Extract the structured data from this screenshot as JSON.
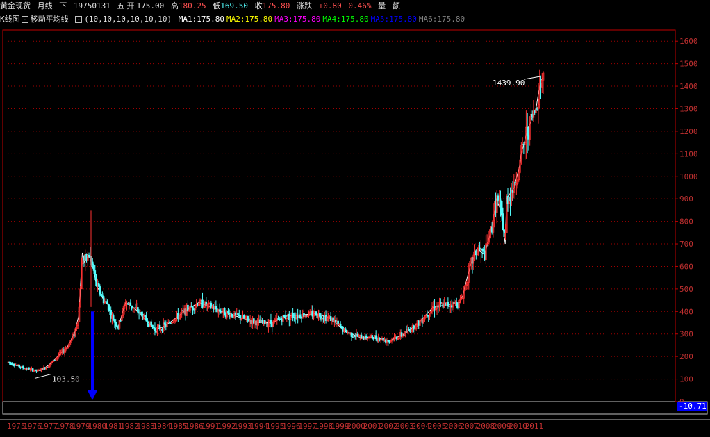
{
  "header": {
    "instrument": "黄金现货",
    "period": "月线",
    "direction": "下",
    "date": "19750131",
    "weekday": "五",
    "open_label": "开",
    "open": "175.00",
    "high_label": "高",
    "high": "180.25",
    "low_label": "低",
    "low": "169.50",
    "close_label": "收",
    "close": "175.80",
    "change_label": "涨跌",
    "change": "+0.80",
    "change_pct": "0.46%",
    "volume_label": "量",
    "amount_label": "额"
  },
  "indicator_bar": {
    "kline_label": "K线图",
    "ma_label": "移动平均线",
    "params": "(10,10,10,10,10,10)",
    "ma": [
      {
        "name": "MA1",
        "value": "175.80",
        "color": "#ffffff"
      },
      {
        "name": "MA2",
        "value": "175.80",
        "color": "#ffff00"
      },
      {
        "name": "MA3",
        "value": "175.80",
        "color": "#ff00ff"
      },
      {
        "name": "MA4",
        "value": "175.80",
        "color": "#00ff00"
      },
      {
        "name": "MA5",
        "value": "175.80",
        "color": "#0000ff"
      },
      {
        "name": "MA6",
        "value": "175.80",
        "color": "#808080"
      }
    ]
  },
  "colors": {
    "up": "#ff3232",
    "down": "#54ffff",
    "grid": "#a00000",
    "axis": "#c00000",
    "arrow": "#0000ff",
    "indicator_box": "#0000ff"
  },
  "chart_data": {
    "type": "line",
    "subtype": "candlestick-monthly",
    "title": "",
    "ylim": [
      0,
      1650
    ],
    "yticks": [
      0,
      100,
      200,
      300,
      400,
      500,
      600,
      700,
      800,
      900,
      1000,
      1100,
      1200,
      1300,
      1400,
      1500,
      1600
    ],
    "grid": true,
    "xticks": [
      "1975",
      "1976",
      "1977",
      "1978",
      "1979",
      "1980",
      "1981",
      "1982",
      "1983",
      "1984",
      "1985",
      "1986",
      "1991",
      "1992",
      "1993",
      "1994",
      "1995",
      "1996",
      "1997",
      "1998",
      "1999",
      "2000",
      "2001",
      "2002",
      "2003",
      "2004",
      "2005",
      "2006",
      "2007",
      "2008",
      "2009",
      "2010",
      "2011"
    ],
    "series": [
      {
        "name": "price",
        "x": [
          "1975",
          "1976",
          "1977",
          "1977.5",
          "1978",
          "1978.5",
          "1979",
          "1979.5",
          "1979.8",
          "1980.05",
          "1980.2",
          "1980.5",
          "1980.8",
          "1981",
          "1981.5",
          "1981.8",
          "1982",
          "1982.5",
          "1983",
          "1983.5",
          "1984",
          "1985",
          "1985.5",
          "1986",
          "1987",
          "1988",
          "1990",
          "1991",
          "1992",
          "1993",
          "1994",
          "1995",
          "1996",
          "1997",
          "1998",
          "1999",
          "2000",
          "2001",
          "2002",
          "2003",
          "2004",
          "2005",
          "2005.8",
          "2006",
          "2006.5",
          "2007",
          "2007.5",
          "2008",
          "2008.3",
          "2008.6",
          "2008.9",
          "2009",
          "2009.5",
          "2009.9",
          "2010",
          "2010.5",
          "2011",
          "2011.3",
          "2011.5"
        ],
        "values": [
          175,
          150,
          135,
          150,
          175,
          210,
          240,
          300,
          380,
          660,
          620,
          650,
          590,
          520,
          450,
          430,
          380,
          330,
          440,
          420,
          390,
          320,
          330,
          350,
          400,
          440,
          390,
          370,
          350,
          350,
          380,
          385,
          390,
          370,
          310,
          285,
          285,
          270,
          300,
          350,
          420,
          430,
          440,
          470,
          600,
          680,
          650,
          780,
          900,
          850,
          700,
          900,
          950,
          1050,
          1100,
          1220,
          1300,
          1420,
          1440
        ]
      }
    ],
    "annotations": [
      {
        "text": "1439.90",
        "x": "2011",
        "y": 1439.9
      },
      {
        "text": "103.50",
        "x": "1976.5",
        "y": 103.5
      }
    ],
    "indicator_value": "-10.71"
  }
}
